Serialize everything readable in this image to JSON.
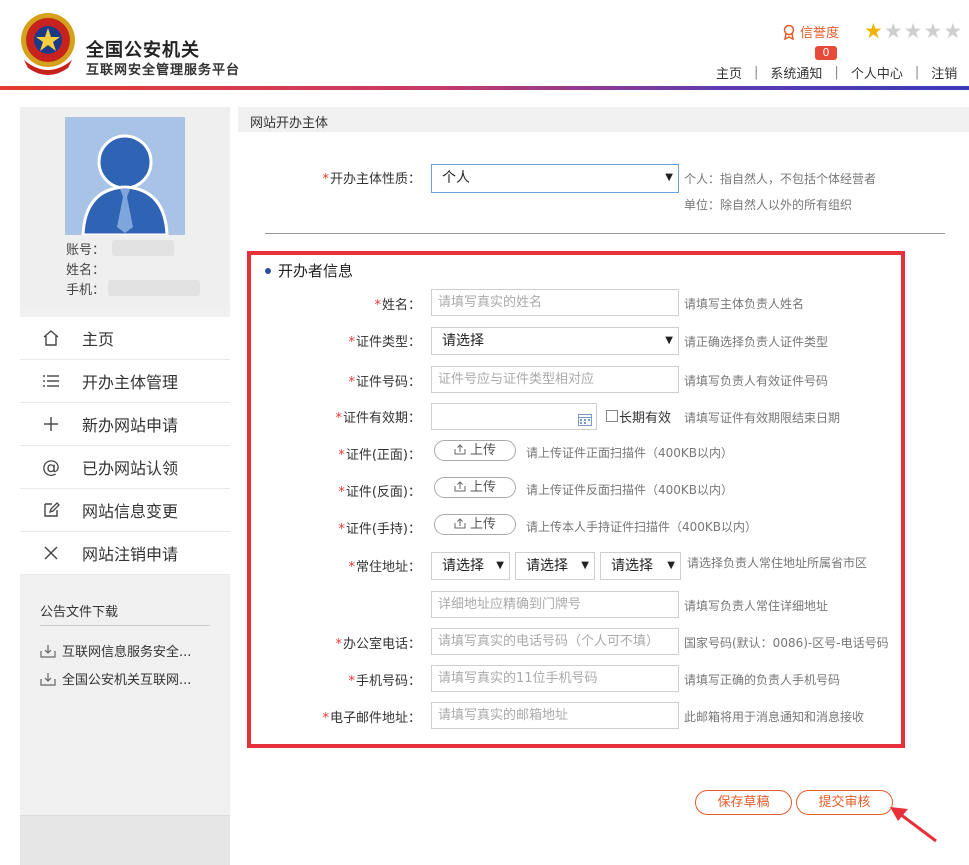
{
  "header": {
    "brand_title": "全国公安机关",
    "brand_subtitle": "互联网安全管理服务平台",
    "reputation_label": "信誉度",
    "notification_count": "0",
    "rating_stars": 1,
    "rating_max": 5,
    "nav": [
      "主页",
      "系统通知",
      "个人中心",
      "注销"
    ]
  },
  "sidebar": {
    "profile": {
      "account_label": "账号：",
      "name_label": "姓名：",
      "phone_label": "手机："
    },
    "menu": [
      {
        "label": "主页",
        "icon": "home-icon"
      },
      {
        "label": "开办主体管理",
        "icon": "list-icon"
      },
      {
        "label": "新办网站申请",
        "icon": "plus-icon"
      },
      {
        "label": "已办网站认领",
        "icon": "at-icon"
      },
      {
        "label": "网站信息变更",
        "icon": "edit-icon"
      },
      {
        "label": "网站注销申请",
        "icon": "close-icon"
      }
    ],
    "downloads_title": "公告文件下载",
    "downloads": [
      "互联网信息服务安全...",
      "全国公安机关互联网..."
    ]
  },
  "main": {
    "title": "网站开办主体",
    "entity_type": {
      "label": "开办主体性质：",
      "value": "个人",
      "hint_1": "个人：指自然人，不包括个体经营者",
      "hint_2": "单位：除自然人以外的所有组织"
    },
    "section_title": "开办者信息",
    "fields": {
      "name": {
        "label": "姓名：",
        "placeholder": "请填写真实的姓名",
        "hint": "请填写主体负责人姓名"
      },
      "id_type": {
        "label": "证件类型：",
        "value": "请选择",
        "hint": "请正确选择负责人证件类型"
      },
      "id_number": {
        "label": "证件号码：",
        "placeholder": "证件号应与证件类型相对应",
        "hint": "请填写负责人有效证件号码"
      },
      "id_validity": {
        "label": "证件有效期：",
        "checkbox_label": "长期有效",
        "hint": "请填写证件有效期限结束日期"
      },
      "id_front": {
        "label": "证件(正面)：",
        "button": "上传",
        "hint": "请上传证件正面扫描件（400KB以内）"
      },
      "id_back": {
        "label": "证件(反面)：",
        "button": "上传",
        "hint": "请上传证件反面扫描件（400KB以内）"
      },
      "id_handheld": {
        "label": "证件(手持)：",
        "button": "上传",
        "hint": "请上传本人手持证件扫描件（400KB以内）"
      },
      "address": {
        "label": "常住地址：",
        "province": "请选择",
        "city": "请选择",
        "district": "请选择",
        "hint": "请选择负责人常住地址所属省市区",
        "detail_placeholder": "详细地址应精确到门牌号",
        "detail_hint": "请填写负责人常住详细地址"
      },
      "office_phone": {
        "label": "办公室电话：",
        "placeholder": "请填写真实的电话号码（个人可不填）",
        "hint": "国家号码(默认：0086)-区号-电话号码"
      },
      "mobile": {
        "label": "手机号码：",
        "placeholder": "请填写真实的11位手机号码",
        "hint": "请填写正确的负责人手机号码"
      },
      "email": {
        "label": "电子邮件地址：",
        "placeholder": "请填写真实的邮箱地址",
        "hint": "此邮箱将用于消息通知和消息接收"
      }
    },
    "buttons": {
      "save_draft": "保存草稿",
      "submit": "提交审核"
    }
  }
}
